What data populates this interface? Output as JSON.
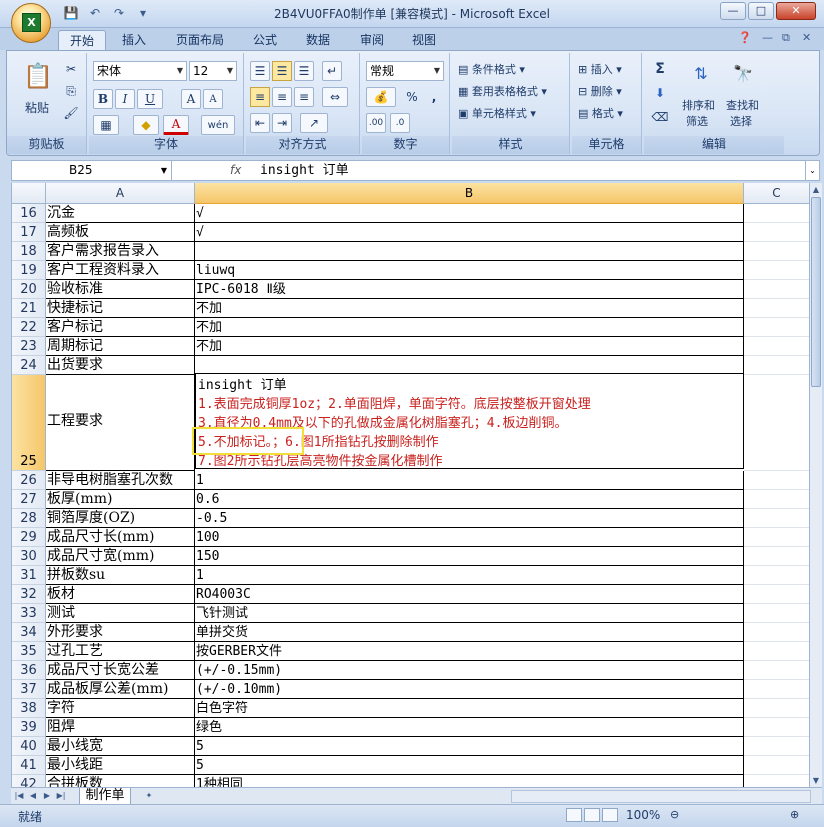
{
  "window": {
    "title": "2B4VU0FFA0制作单  [兼容模式] - Microsoft Excel",
    "orb_label": "X"
  },
  "qat": [
    "save-icon",
    "undo-icon",
    "redo-icon",
    "customize-icon"
  ],
  "tabs": [
    "开始",
    "插入",
    "页面布局",
    "公式",
    "数据",
    "审阅",
    "视图"
  ],
  "ribbon": {
    "clipboard": {
      "paste": "粘贴",
      "label": "剪贴板"
    },
    "font": {
      "name": "宋体",
      "size": "12",
      "label": "字体",
      "bold": "B",
      "italic": "I",
      "underline": "U",
      "grow": "A",
      "shrink": "A",
      "font_color": "A",
      "wen": "wén"
    },
    "align": {
      "label": "对齐方式"
    },
    "number": {
      "format": "常规",
      "label": "数字",
      "percent": "%",
      "comma": ","
    },
    "styles": {
      "cond": "条件格式",
      "table": "套用表格格式",
      "cell": "单元格样式",
      "label": "样式"
    },
    "cells": {
      "insert": "插入",
      "delete": "删除",
      "format": "格式",
      "label": "单元格"
    },
    "edit": {
      "sort1": "排序和",
      "sort2": "筛选",
      "find1": "查找和",
      "find2": "选择",
      "label": "编辑",
      "sigma": "Σ"
    }
  },
  "formula": {
    "name_box": "B25",
    "fx": "fx",
    "value": "insight 订单"
  },
  "columns": [
    "A",
    "B",
    "C"
  ],
  "rows": [
    {
      "n": "16",
      "a": "沉金",
      "b": "√"
    },
    {
      "n": "17",
      "a": "高频板",
      "b": "√"
    },
    {
      "n": "18",
      "a": "客户需求报告录入",
      "b": ""
    },
    {
      "n": "19",
      "a": "客户工程资料录入",
      "b": "liuwq"
    },
    {
      "n": "20",
      "a": "验收标准",
      "b": "IPC-6018 Ⅱ级"
    },
    {
      "n": "21",
      "a": "快捷标记",
      "b": "不加"
    },
    {
      "n": "22",
      "a": "客户标记",
      "b": "不加"
    },
    {
      "n": "23",
      "a": "周期标记",
      "b": "不加"
    },
    {
      "n": "24",
      "a": "出货要求",
      "b": ""
    },
    {
      "n": "25",
      "a": "工程要求",
      "b": ""
    },
    {
      "n": "26",
      "a": "非导电树脂塞孔次数",
      "b": "1"
    },
    {
      "n": "27",
      "a": "板厚(mm)",
      "b": "0.6"
    },
    {
      "n": "28",
      "a": "铜箔厚度(OZ)",
      "b": "-0.5"
    },
    {
      "n": "29",
      "a": "成品尺寸长(mm)",
      "b": "100"
    },
    {
      "n": "30",
      "a": "成品尺寸宽(mm)",
      "b": "150"
    },
    {
      "n": "31",
      "a": "拼板数su",
      "b": "1"
    },
    {
      "n": "32",
      "a": "板材",
      "b": "RO4003C"
    },
    {
      "n": "33",
      "a": "测试",
      "b": "飞针测试"
    },
    {
      "n": "34",
      "a": "外形要求",
      "b": "单拼交货"
    },
    {
      "n": "35",
      "a": "过孔工艺",
      "b": "按GERBER文件"
    },
    {
      "n": "36",
      "a": "成品尺寸长宽公差",
      "b": "(+/-0.15mm)"
    },
    {
      "n": "37",
      "a": "成品板厚公差(mm)",
      "b": "(+/-0.10mm)"
    },
    {
      "n": "38",
      "a": "字符",
      "b": "白色字符"
    },
    {
      "n": "39",
      "a": "阻焊",
      "b": "绿色"
    },
    {
      "n": "40",
      "a": "最小线宽",
      "b": "5"
    },
    {
      "n": "41",
      "a": "最小线距",
      "b": "5"
    },
    {
      "n": "42",
      "a": "合拼板数",
      "b": "1种相同"
    }
  ],
  "b25": {
    "line0": "insight 订单",
    "line1": "1.表面完成铜厚1oz；2.单面阻焊，单面字符。底层按整板开窗处理",
    "line2": "3.直径为0.4mm及以下的孔做成金属化树脂塞孔；4.板边削铜。",
    "line3": "5.不加标记。；6.图1所指钻孔按删除制作",
    "line4": "7.图2所示钻孔层高亮物件按金属化槽制作"
  },
  "sheet_tab": "制作单",
  "status": {
    "ready": "就绪",
    "zoom": "100%"
  }
}
